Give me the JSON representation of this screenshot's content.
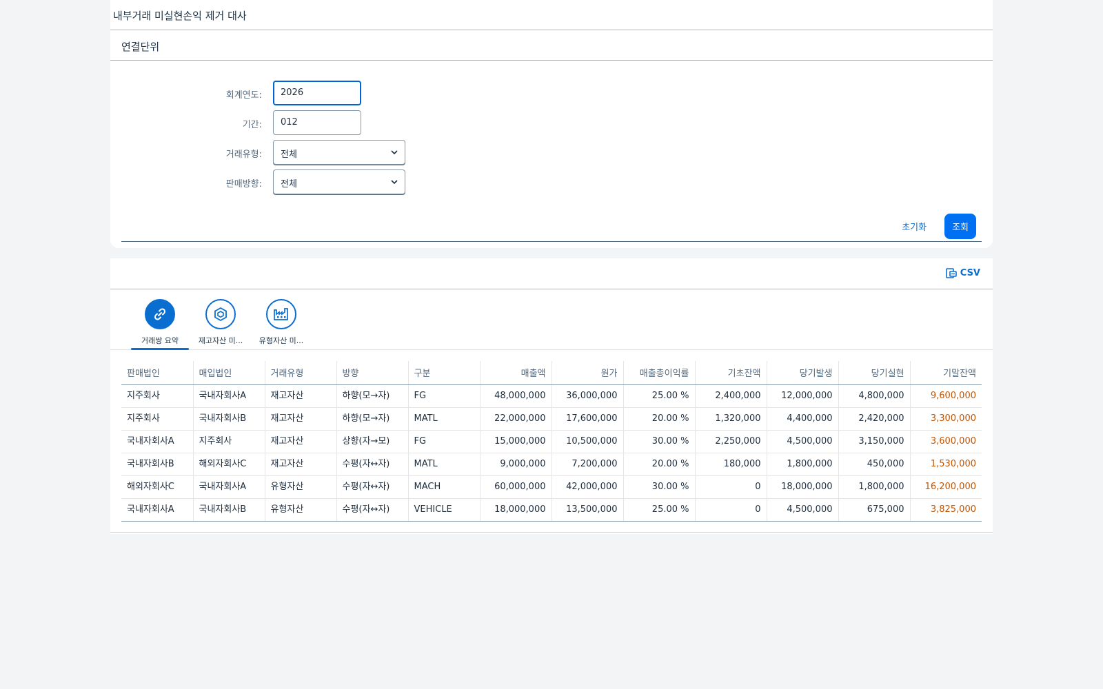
{
  "header": {
    "title": "내부거래 미실현손익 제거 대사"
  },
  "filter": {
    "title": "연결단위",
    "fiscal_year_label": "회계연도:",
    "fiscal_year_value": "2026",
    "period_label": "기간:",
    "period_value": "012",
    "trans_type_label": "거래유형:",
    "trans_type_value": "전체",
    "sales_dir_label": "판매방향:",
    "sales_dir_value": "전체",
    "reset_label": "초기화",
    "search_label": "조회"
  },
  "toolbar": {
    "csv_label": "CSV"
  },
  "tabs": [
    {
      "label": "거래쌍 요약",
      "icon": "link-icon",
      "active": true
    },
    {
      "label": "재고자산 미...",
      "icon": "inventory-icon",
      "active": false
    },
    {
      "label": "유형자산 미...",
      "icon": "factory-icon",
      "active": false
    }
  ],
  "table": {
    "columns": [
      "판매법인",
      "매입법인",
      "거래유형",
      "방향",
      "구분",
      "매출액",
      "원가",
      "매출총이익률",
      "기초잔액",
      "당기발생",
      "당기실현",
      "기말잔액"
    ],
    "rows": [
      [
        "지주회사",
        "국내자회사A",
        "재고자산",
        "하향(모→자)",
        "FG",
        "48,000,000",
        "36,000,000",
        "25.00 %",
        "2,400,000",
        "12,000,000",
        "4,800,000",
        "9,600,000"
      ],
      [
        "지주회사",
        "국내자회사B",
        "재고자산",
        "하향(모→자)",
        "MATL",
        "22,000,000",
        "17,600,000",
        "20.00 %",
        "1,320,000",
        "4,400,000",
        "2,420,000",
        "3,300,000"
      ],
      [
        "국내자회사A",
        "지주회사",
        "재고자산",
        "상향(자→모)",
        "FG",
        "15,000,000",
        "10,500,000",
        "30.00 %",
        "2,250,000",
        "4,500,000",
        "3,150,000",
        "3,600,000"
      ],
      [
        "국내자회사B",
        "해외자회사C",
        "재고자산",
        "수평(자↔자)",
        "MATL",
        "9,000,000",
        "7,200,000",
        "20.00 %",
        "180,000",
        "1,800,000",
        "450,000",
        "1,530,000"
      ],
      [
        "해외자회사C",
        "국내자회사A",
        "유형자산",
        "수평(자↔자)",
        "MACH",
        "60,000,000",
        "42,000,000",
        "30.00 %",
        "0",
        "18,000,000",
        "1,800,000",
        "16,200,000"
      ],
      [
        "국내자회사A",
        "국내자회사B",
        "유형자산",
        "수평(자↔자)",
        "VEHICLE",
        "18,000,000",
        "13,500,000",
        "25.00 %",
        "0",
        "4,500,000",
        "675,000",
        "3,825,000"
      ]
    ]
  },
  "colors": {
    "accent": "#0a6ed1",
    "primary_button": "#0070f2",
    "end_balance": "#c35500"
  }
}
